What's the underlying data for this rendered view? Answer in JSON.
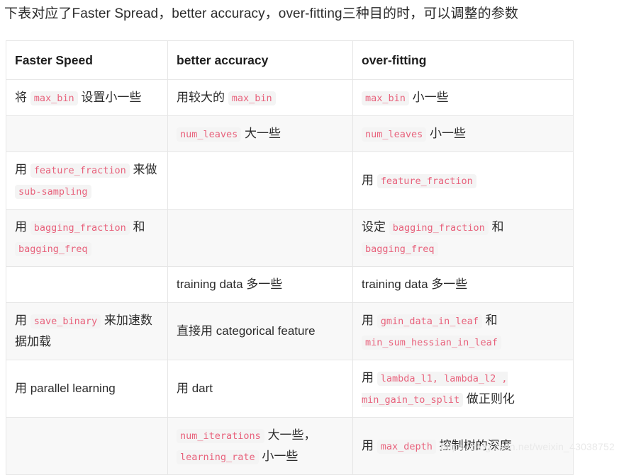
{
  "intro": {
    "text": "下表对应了Faster Spread，better accuracy，over-fitting三种目的时，可以调整的参数"
  },
  "table": {
    "headers": [
      {
        "label": "Faster Speed"
      },
      {
        "label": "better accuracy"
      },
      {
        "label": "over-fitting"
      }
    ],
    "rows": [
      {
        "faster_speed": [
          {
            "type": "text",
            "value": "将 "
          },
          {
            "type": "code",
            "value": "max_bin"
          },
          {
            "type": "text",
            "value": " 设置小一些"
          }
        ],
        "better_accuracy": [
          {
            "type": "text",
            "value": "用较大的 "
          },
          {
            "type": "code",
            "value": "max_bin"
          }
        ],
        "over_fitting": [
          {
            "type": "code",
            "value": "max_bin"
          },
          {
            "type": "text",
            "value": " 小一些"
          }
        ]
      },
      {
        "faster_speed": [],
        "better_accuracy": [
          {
            "type": "code",
            "value": "num_leaves"
          },
          {
            "type": "text",
            "value": " 大一些"
          }
        ],
        "over_fitting": [
          {
            "type": "code",
            "value": "num_leaves"
          },
          {
            "type": "text",
            "value": " 小一些"
          }
        ]
      },
      {
        "faster_speed": [
          {
            "type": "text",
            "value": "用 "
          },
          {
            "type": "code",
            "value": "feature_fraction"
          },
          {
            "type": "text",
            "value": " 来做 "
          },
          {
            "type": "code",
            "value": "sub-sampling"
          }
        ],
        "better_accuracy": [],
        "over_fitting": [
          {
            "type": "text",
            "value": "用 "
          },
          {
            "type": "code",
            "value": "feature_fraction"
          }
        ]
      },
      {
        "faster_speed": [
          {
            "type": "text",
            "value": "用 "
          },
          {
            "type": "code",
            "value": "bagging_fraction"
          },
          {
            "type": "text",
            "value": " 和 "
          },
          {
            "type": "code",
            "value": "bagging_freq"
          }
        ],
        "better_accuracy": [],
        "over_fitting": [
          {
            "type": "text",
            "value": "设定 "
          },
          {
            "type": "code",
            "value": "bagging_fraction"
          },
          {
            "type": "text",
            "value": " 和 "
          },
          {
            "type": "code",
            "value": "bagging_freq"
          }
        ]
      },
      {
        "faster_speed": [],
        "better_accuracy": [
          {
            "type": "text",
            "value": "training data 多一些"
          }
        ],
        "over_fitting": [
          {
            "type": "text",
            "value": "training data 多一些"
          }
        ]
      },
      {
        "faster_speed": [
          {
            "type": "text",
            "value": "用 "
          },
          {
            "type": "code",
            "value": "save_binary"
          },
          {
            "type": "text",
            "value": " 来加速数据加载"
          }
        ],
        "better_accuracy": [
          {
            "type": "text",
            "value": "直接用 categorical feature"
          }
        ],
        "over_fitting": [
          {
            "type": "text",
            "value": "用 "
          },
          {
            "type": "code",
            "value": "gmin_data_in_leaf"
          },
          {
            "type": "text",
            "value": " 和 "
          },
          {
            "type": "code",
            "value": "min_sum_hessian_in_leaf"
          }
        ]
      },
      {
        "faster_speed": [
          {
            "type": "text",
            "value": "用 parallel learning"
          }
        ],
        "better_accuracy": [
          {
            "type": "text",
            "value": "用 dart"
          }
        ],
        "over_fitting": [
          {
            "type": "text",
            "value": "用 "
          },
          {
            "type": "code",
            "value": "lambda_l1, lambda_l2 , min_gain_to_split"
          },
          {
            "type": "text",
            "value": " 做正则化"
          }
        ]
      },
      {
        "faster_speed": [],
        "better_accuracy": [
          {
            "type": "code",
            "value": "num_iterations"
          },
          {
            "type": "text",
            "value": " 大一些， "
          },
          {
            "type": "code",
            "value": "learning_rate"
          },
          {
            "type": "text",
            "value": " 小一些"
          }
        ],
        "over_fitting": [
          {
            "type": "text",
            "value": "用 "
          },
          {
            "type": "code",
            "value": "max_depth"
          },
          {
            "type": "text",
            "value": " 控制树的深度"
          }
        ]
      }
    ]
  },
  "watermark": {
    "text": "https://blog.csdn.net/weixin_43038752"
  },
  "colors": {
    "code_text": "#e8627c",
    "code_background": "#f4f4f4",
    "table_border": "#e6e6e6",
    "row_stripe": "#f8f8f8",
    "body_text": "#2b2b2b",
    "watermark": "#e9e9e9"
  }
}
